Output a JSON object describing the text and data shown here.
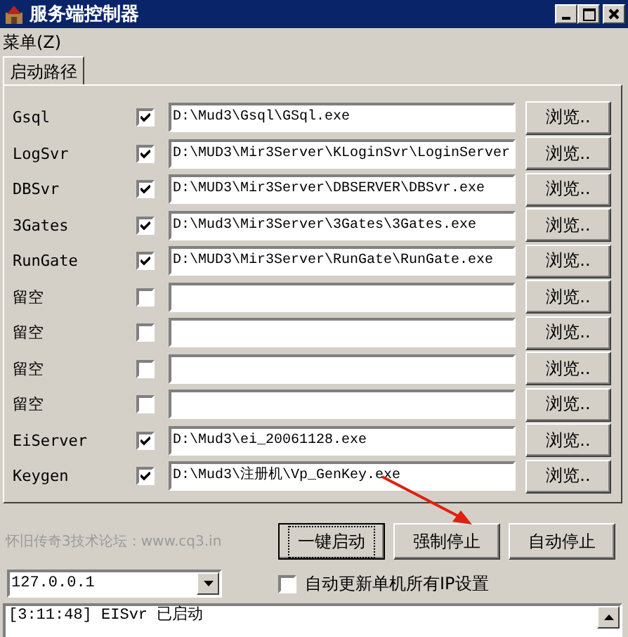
{
  "window": {
    "title": "服务端控制器"
  },
  "menu": [
    {
      "label": "菜单(Z)"
    }
  ],
  "tabs": [
    {
      "label": "启动路径",
      "selected": true
    }
  ],
  "servers": [
    {
      "name": "Gsql",
      "checked": true,
      "path": "D:\\Mud3\\Gsql\\GSql.exe",
      "browse": "浏览.."
    },
    {
      "name": "LogSvr",
      "checked": true,
      "path": "D:\\MUD3\\Mir3Server\\KLoginSvr\\LoginServer",
      "browse": "浏览.."
    },
    {
      "name": "DBSvr",
      "checked": true,
      "path": "D:\\MUD3\\Mir3Server\\DBSERVER\\DBSvr.exe",
      "browse": "浏览.."
    },
    {
      "name": "3Gates",
      "checked": true,
      "path": "D:\\Mud3\\Mir3Server\\3Gates\\3Gates.exe",
      "browse": "浏览.."
    },
    {
      "name": "RunGate",
      "checked": true,
      "path": "D:\\MUD3\\Mir3Server\\RunGate\\RunGate.exe",
      "browse": "浏览.."
    },
    {
      "name": "留空",
      "checked": false,
      "browse": "浏览.."
    },
    {
      "name": "留空",
      "checked": false,
      "browse": "浏览.."
    },
    {
      "name": "留空",
      "checked": false,
      "browse": "浏览.."
    },
    {
      "name": "留空",
      "checked": false,
      "browse": "浏览.."
    },
    {
      "name": "EiServer",
      "checked": true,
      "path": "D:\\Mud3\\ei_20061128.exe",
      "browse": "浏览.."
    },
    {
      "name": "Keygen",
      "checked": true,
      "path": "D:\\Mud3\\注册机\\Vp_GenKey.exe",
      "browse": "浏览.."
    }
  ],
  "forum_text": "怀旧传奇3技术论坛：www.cq3.in",
  "actions": [
    {
      "label": "一键启动",
      "focused": true
    },
    {
      "label": "强制停止",
      "focused": false
    },
    {
      "label": "自动停止",
      "focused": false
    }
  ],
  "ip_select": {
    "value": "127.0.0.1"
  },
  "auto_update": {
    "label": "自动更新单机所有IP设置",
    "checked": false
  },
  "log": [
    "[3:11:48] EISvr 已启动"
  ]
}
